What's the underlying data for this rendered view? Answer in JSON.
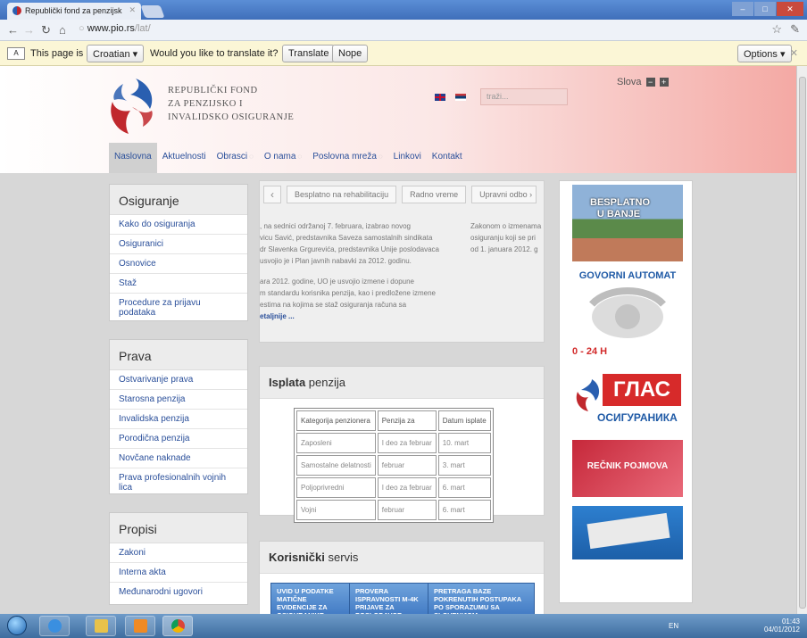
{
  "browser": {
    "tab_title": "Republički fond za penzijsk",
    "url_host": "www.pio.rs",
    "url_path": "/lat/"
  },
  "translate_bar": {
    "text_prefix": "This page is in",
    "language": "Croatian",
    "question": "Would you like to translate it?",
    "translate_btn": "Translate",
    "nope_btn": "Nope",
    "options_btn": "Options"
  },
  "site": {
    "logo_line1": "REPUBLIČKI FOND",
    "logo_line2": "ZA PENZIJSKO I",
    "logo_line3": "INVALIDSKO OSIGURANJE",
    "search_placeholder": "traži...",
    "slova_label": "Slova",
    "slova_minus": "−",
    "slova_plus": "+",
    "menu": [
      {
        "label": "Naslovna"
      },
      {
        "label": "Aktuelnosti"
      },
      {
        "label": "Obrasci"
      },
      {
        "label": "O nama"
      },
      {
        "label": "Poslovna mreža"
      },
      {
        "label": "Linkovi"
      },
      {
        "label": "Kontakt"
      }
    ]
  },
  "sidebar": {
    "osiguranje": {
      "title": "Osiguranje",
      "links": [
        "Kako do osiguranja",
        "Osiguranici",
        "Osnovice",
        "Staž",
        "Procedure za prijavu podataka"
      ]
    },
    "prava": {
      "title": "Prava",
      "links": [
        "Ostvarivanje prava",
        "Starosna penzija",
        "Invalidska penzija",
        "Porodična penzija",
        "Novčane naknade",
        "Prava profesionalnih vojnih lica"
      ]
    },
    "propisi": {
      "title": "Propisi",
      "links": [
        "Zakoni",
        "Interna akta",
        "Međunarodni ugovori"
      ]
    }
  },
  "slider": {
    "tabs": [
      "Besplatno na rehabilitaciju",
      "Radno vreme",
      "Upravni odbo"
    ],
    "text_lines": [
      ", na sednici održanoj 7. februara, izabrao novog",
      "vicu Savić, predstavnika Saveza samostalnih sindikata",
      "dr Slavenka Grgurevića, predstavnika Unije poslodavaca",
      "usvojio je i Plan javnih nabavki za 2012. godinu.",
      "",
      "ara 2012. godine, UO je usvojio izmene i dopune",
      "m standardu korisnika penzija, kao i predložene izmene",
      "estima na kojima se staž osiguranja računa sa"
    ],
    "more": "etaljnije ...",
    "side_lines": [
      "Zakonom o izmenama",
      "osiguranju koji se pri",
      "od 1. januara 2012. g"
    ]
  },
  "isplata": {
    "title_bold": "Isplata",
    "title_rest": " penzija",
    "headers": [
      "Kategorija penzionera",
      "Penzija za",
      "Datum isplate"
    ],
    "rows": [
      [
        "Zaposleni",
        "I deo za februar",
        "10. mart"
      ],
      [
        "Samostalne delatnosti",
        "februar",
        "3. mart"
      ],
      [
        "Poljoprivredni",
        "I deo za februar",
        "6. mart"
      ],
      [
        "Vojni",
        "februar",
        "6. mart"
      ]
    ]
  },
  "servis": {
    "title_bold": "Korisnički",
    "title_rest": " servis",
    "cells": [
      "UVID U PODATKE MATIČNE EVIDENCIJE ZA OSIGURANIKE",
      "PROVERA ISPRAVNOSTI M-4K PRIJAVE ZA POSLODAVCE",
      "PRETRAGA BAZE POKRENUTIH POSTUPAKA PO SPORAZUMU SA SLOVENIJOM"
    ]
  },
  "banners": {
    "banja": "BESPLATNO U BANJE",
    "govorni_title": "GOVORNI AUTOMAT",
    "govorni_hours": "0 - 24 H",
    "glas_line1": "ГЛАС",
    "glas_line2": "ОСИГУРАНИКА",
    "recnik": "REČNIK POJMOVA"
  },
  "taskbar": {
    "lang": "EN",
    "time": "01:43",
    "date": "04/01/2012"
  }
}
